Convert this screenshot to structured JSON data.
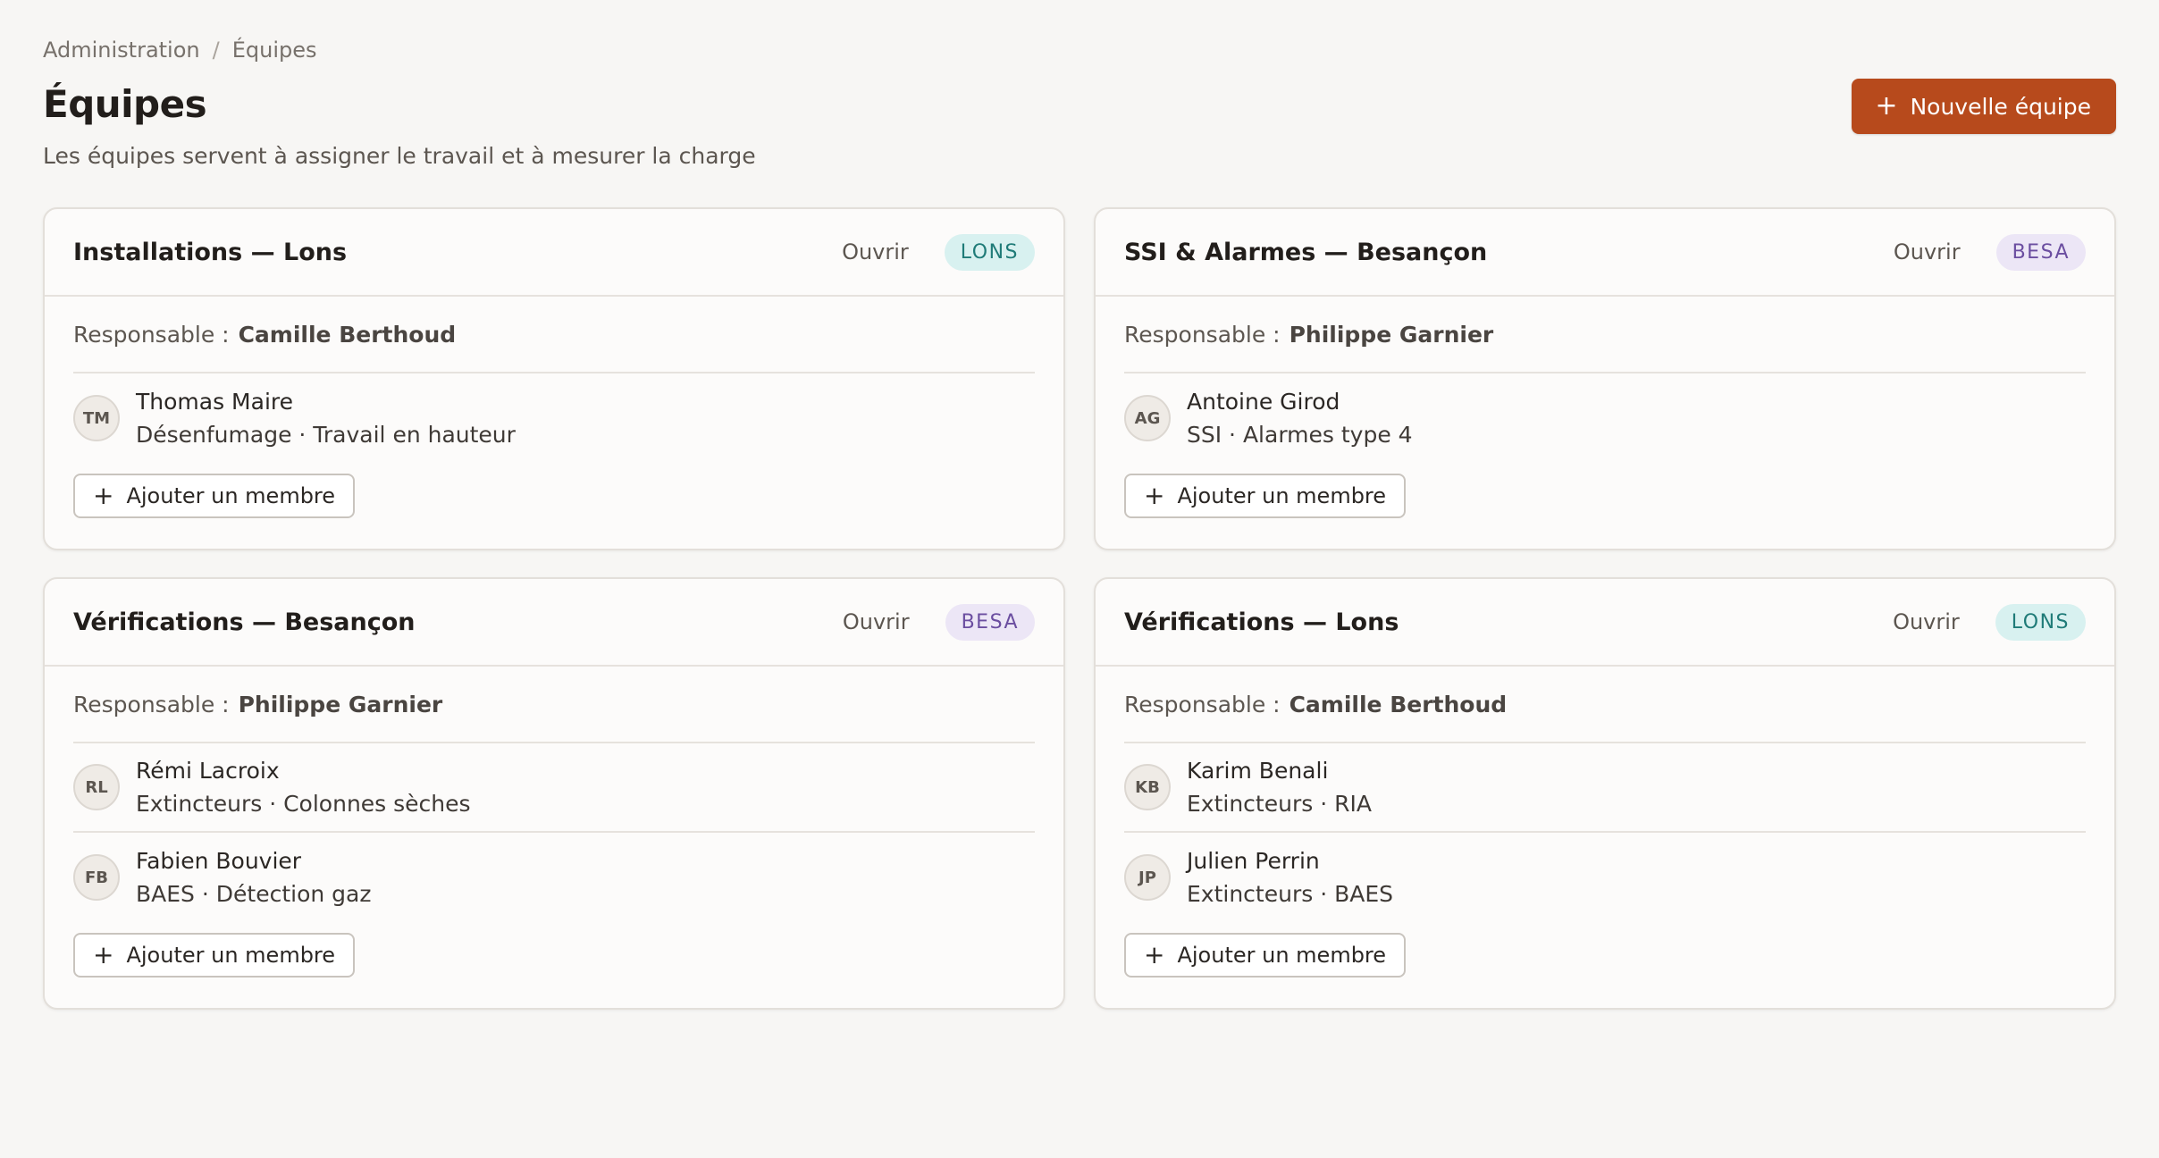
{
  "breadcrumb": {
    "root": "Administration",
    "separator": "/",
    "current": "Équipes"
  },
  "header": {
    "title": "Équipes",
    "subtitle": "Les équipes servent à assigner le travail et à mesurer la charge",
    "new_team_label": "Nouvelle équipe"
  },
  "labels": {
    "open": "Ouvrir",
    "manager": "Responsable :",
    "add_member": "Ajouter un membre"
  },
  "teams": [
    {
      "name": "Installations — Lons",
      "site": "LONS",
      "manager": "Camille Berthoud",
      "members": [
        {
          "initials": "TM",
          "name": "Thomas Maire",
          "skills": "Désenfumage · Travail en hauteur"
        }
      ]
    },
    {
      "name": "SSI & Alarmes — Besançon",
      "site": "BESA",
      "manager": "Philippe Garnier",
      "members": [
        {
          "initials": "AG",
          "name": "Antoine Girod",
          "skills": "SSI · Alarmes type 4"
        }
      ]
    },
    {
      "name": "Vérifications — Besançon",
      "site": "BESA",
      "manager": "Philippe Garnier",
      "members": [
        {
          "initials": "RL",
          "name": "Rémi Lacroix",
          "skills": "Extincteurs · Colonnes sèches"
        },
        {
          "initials": "FB",
          "name": "Fabien Bouvier",
          "skills": "BAES · Détection gaz"
        }
      ]
    },
    {
      "name": "Vérifications — Lons",
      "site": "LONS",
      "manager": "Camille Berthoud",
      "members": [
        {
          "initials": "KB",
          "name": "Karim Benali",
          "skills": "Extincteurs · RIA"
        },
        {
          "initials": "JP",
          "name": "Julien Perrin",
          "skills": "Extincteurs · BAES"
        }
      ]
    }
  ],
  "colors": {
    "accent": "#b74a1c",
    "lons_badge_bg": "#d8f1f0",
    "lons_badge_fg": "#1f7b78",
    "besa_badge_bg": "#ece6f6",
    "besa_badge_fg": "#6b4ea0"
  },
  "icons": {
    "add": "plus-icon"
  }
}
